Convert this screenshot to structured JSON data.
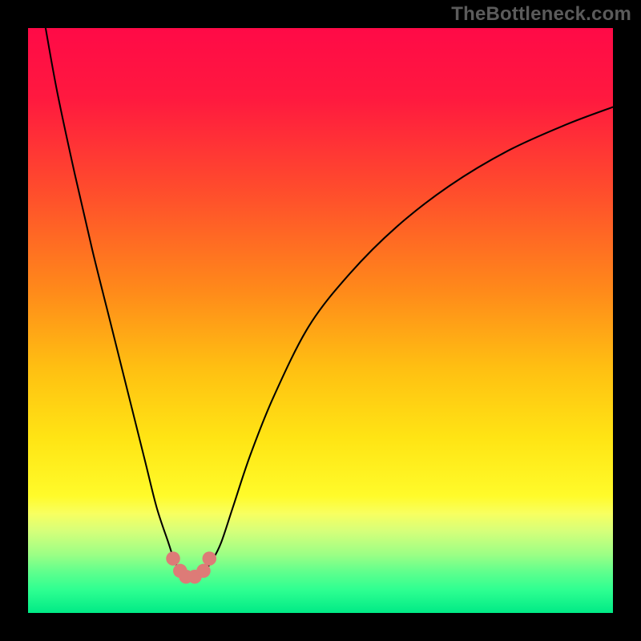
{
  "watermark": "TheBottleneck.com",
  "colors": {
    "frame_bg": "#000000",
    "watermark_text": "#5b5b5b",
    "curve_stroke": "#000000",
    "dot_fill": "#dd7b77",
    "gradient_top": "#ff0a47",
    "gradient_bottom": "#00ea86"
  },
  "chart_data": {
    "type": "line",
    "title": "",
    "xlabel": "",
    "ylabel": "",
    "xlim": [
      0,
      100
    ],
    "ylim": [
      0,
      100
    ],
    "series": [
      {
        "name": "curve",
        "x": [
          3,
          5,
          8,
          11,
          14,
          17,
          20,
          22,
          24,
          25,
          26,
          27,
          28,
          29,
          30,
          31.5,
          33,
          35,
          38,
          42,
          48,
          55,
          63,
          72,
          82,
          92,
          100
        ],
        "y": [
          100,
          89,
          75,
          62,
          50,
          38,
          26,
          18,
          12,
          9,
          7.2,
          6.4,
          6.1,
          6.3,
          7.0,
          9,
          12,
          18,
          27,
          37,
          49,
          58,
          66,
          73,
          79,
          83.5,
          86.5
        ]
      }
    ],
    "marker_points": {
      "name": "dots",
      "x": [
        24.8,
        26.0,
        27.0,
        28.5,
        30.0,
        31.0
      ],
      "y": [
        9.3,
        7.2,
        6.2,
        6.2,
        7.2,
        9.3
      ]
    },
    "background_gradient_stops": [
      {
        "pos": 0.0,
        "color": "#ff0a47"
      },
      {
        "pos": 0.12,
        "color": "#ff193f"
      },
      {
        "pos": 0.28,
        "color": "#ff4d2c"
      },
      {
        "pos": 0.45,
        "color": "#ff8a1a"
      },
      {
        "pos": 0.58,
        "color": "#ffbf12"
      },
      {
        "pos": 0.7,
        "color": "#ffe414"
      },
      {
        "pos": 0.8,
        "color": "#fffb2a"
      },
      {
        "pos": 0.83,
        "color": "#f8ff60"
      },
      {
        "pos": 0.86,
        "color": "#d6ff7a"
      },
      {
        "pos": 0.9,
        "color": "#9cff85"
      },
      {
        "pos": 0.93,
        "color": "#5fff8d"
      },
      {
        "pos": 0.96,
        "color": "#2fff91"
      },
      {
        "pos": 1.0,
        "color": "#00ea86"
      }
    ]
  }
}
